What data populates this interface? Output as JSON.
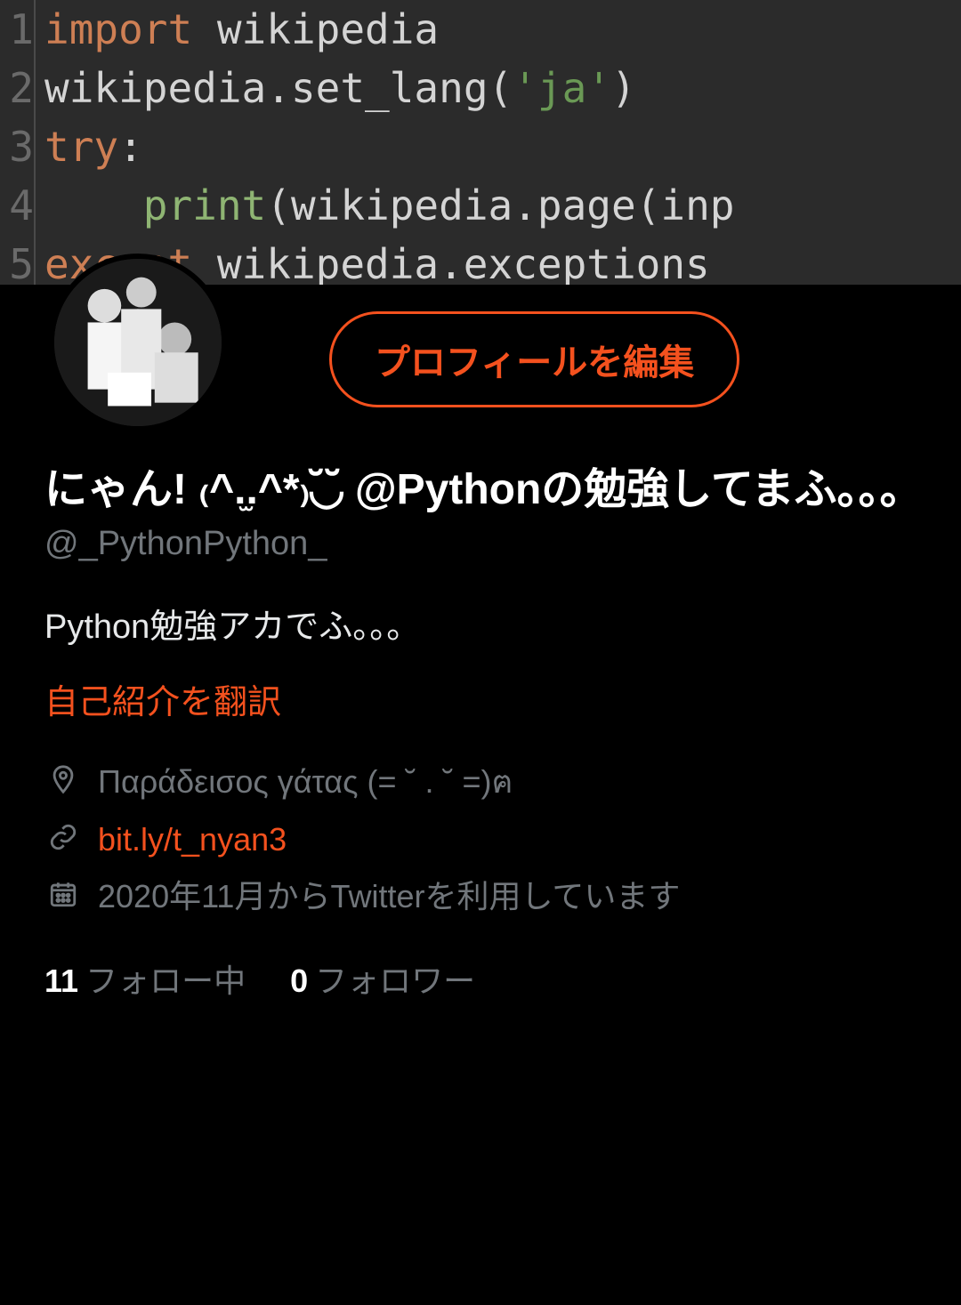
{
  "banner_code": {
    "lines": [
      {
        "n": "1",
        "segments": [
          {
            "t": "import",
            "c": "kw"
          },
          {
            "t": " wikipedia",
            "c": "dim"
          }
        ]
      },
      {
        "n": "2",
        "segments": [
          {
            "t": "wikipedia",
            "c": "dim"
          },
          {
            "t": ".",
            "c": "dim"
          },
          {
            "t": "set_lang",
            "c": "dim"
          },
          {
            "t": "(",
            "c": "dim"
          },
          {
            "t": "'ja'",
            "c": "str"
          },
          {
            "t": ")",
            "c": "dim"
          }
        ]
      },
      {
        "n": "3",
        "segments": [
          {
            "t": "try",
            "c": "kw"
          },
          {
            "t": ":",
            "c": "dim"
          }
        ]
      },
      {
        "n": "4",
        "segments": [
          {
            "t": "    ",
            "c": "dim"
          },
          {
            "t": "print",
            "c": "builtin"
          },
          {
            "t": "(wikipedia.page(inp",
            "c": "dim"
          }
        ]
      },
      {
        "n": "5",
        "segments": [
          {
            "t": "except",
            "c": "kw"
          },
          {
            "t": " wikipedia.exceptions",
            "c": "dim"
          }
        ]
      }
    ]
  },
  "edit_button": "プロフィールを編集",
  "display_name": "にゃん! ₍^.̫.^*₎◟̆◞̆ @Pythonの勉強してまふ。。。",
  "handle": "@_PythonPython_",
  "bio": "Python勉強アカでふ。。。",
  "translate": "自己紹介を翻訳",
  "meta": {
    "location": "Παράδεισος γάτας (= ˘ . ˘ =)ฅ",
    "link": "bit.ly/t_nyan3",
    "joined": "2020年11月からTwitterを利用しています"
  },
  "follow": {
    "following_count": "11",
    "following_label": "フォロー中",
    "followers_count": "0",
    "followers_label": "フォロワー"
  }
}
